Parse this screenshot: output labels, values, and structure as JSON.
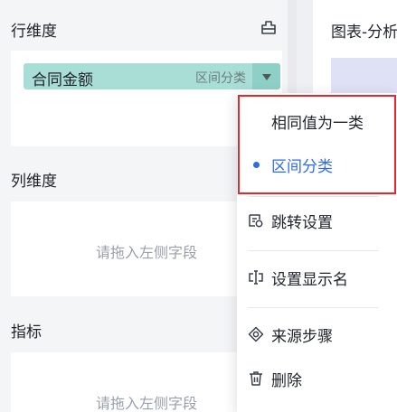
{
  "left_panel": {
    "row_dimension": {
      "title": "行维度",
      "chip": {
        "name": "合同金额",
        "tag": "区间分类"
      }
    },
    "column_dimension": {
      "title": "列维度",
      "hint": "请拖入左侧字段"
    },
    "metrics": {
      "title": "指标",
      "hint": "请拖入左侧字段"
    }
  },
  "right_panel": {
    "title": "图表-分析"
  },
  "context_menu": {
    "group_options": [
      {
        "label": "相同值为一类",
        "selected": false
      },
      {
        "label": "区间分类",
        "selected": true
      }
    ],
    "actions": [
      {
        "label": "跳转设置",
        "icon": "jump-link-icon"
      },
      {
        "label": "设置显示名",
        "icon": "rename-icon"
      },
      {
        "label": "来源步骤",
        "icon": "source-step-icon"
      },
      {
        "label": "删除",
        "icon": "trash-icon"
      }
    ]
  },
  "colors": {
    "chip_bg": "#a8ded6",
    "accent_blue": "#2e6be6",
    "highlight_red": "#e8272d"
  }
}
